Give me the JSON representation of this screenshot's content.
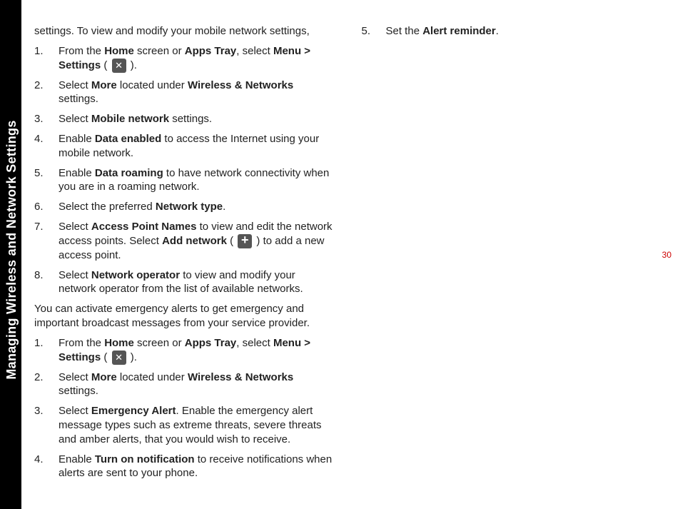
{
  "sidebar": {
    "label": "Managing Wireless and Network Settings"
  },
  "page_number": "30",
  "intro1": "settings. To view and modify your mobile network settings,",
  "list1": {
    "i1": {
      "num": "1.",
      "a": "From the ",
      "b": "Home",
      "c": " screen or ",
      "d": "Apps Tray",
      "e": ", select ",
      "f": "Menu > Settings",
      "g": " ( ",
      "h": " )."
    },
    "i2": {
      "num": "2.",
      "a": "Select ",
      "b": "More",
      "c": " located under ",
      "d": "Wireless & Networks",
      "e": " settings."
    },
    "i3": {
      "num": "3.",
      "a": "Select ",
      "b": "Mobile network",
      "c": " settings."
    },
    "i4": {
      "num": "4.",
      "a": "Enable ",
      "b": "Data enabled",
      "c": " to access the Internet using your mobile network."
    },
    "i5": {
      "num": "5.",
      "a": "Enable ",
      "b": "Data roaming",
      "c": " to have network connectivity when you are in a roaming network."
    },
    "i6": {
      "num": "6.",
      "a": "Select the preferred ",
      "b": "Network type",
      "c": "."
    },
    "i7": {
      "num": "7.",
      "a": "Select ",
      "b": "Access Point Names",
      "c": " to view and edit the network access points. Select ",
      "d": "Add network",
      "e": " ( ",
      "f": " ) to add a new access point."
    },
    "i8": {
      "num": "8.",
      "a": "Select ",
      "b": "Network operator",
      "c": " to view and modify your network operator from the list of available networks."
    }
  },
  "intro2": "You can activate emergency alerts to get emergency and important broadcast messages from your service provider.",
  "list2": {
    "i1": {
      "num": "1.",
      "a": "From the ",
      "b": "Home",
      "c": " screen or ",
      "d": "Apps Tray",
      "e": ", select ",
      "f": "Menu > Settings",
      "g": " ( ",
      "h": " )."
    },
    "i2": {
      "num": "2.",
      "a": "Select ",
      "b": "More",
      "c": " located under ",
      "d": "Wireless & Networks",
      "e": " settings."
    },
    "i3": {
      "num": "3.",
      "a": "Select ",
      "b": "Emergency Alert",
      "c": ". Enable the emergency alert message types such as extreme threats, severe threats and amber alerts, that you would wish to receive."
    },
    "i4": {
      "num": "4.",
      "a": "Enable ",
      "b": "Turn on notification",
      "c": " to receive notifications when alerts are sent to your phone."
    },
    "i5": {
      "num": "5.",
      "a": "Set the ",
      "b": "Alert reminder",
      "c": "."
    }
  }
}
